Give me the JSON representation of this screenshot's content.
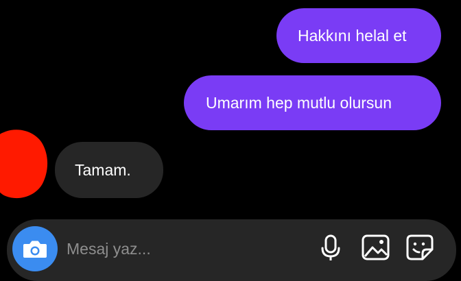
{
  "messages": [
    {
      "sender": "me",
      "text": "Hakkını helal et"
    },
    {
      "sender": "me",
      "text": "Umarım hep mutlu olursun"
    },
    {
      "sender": "other",
      "text": "Tamam."
    }
  ],
  "composer": {
    "placeholder": "Mesaj yaz..."
  },
  "icons": {
    "camera": "camera-icon",
    "microphone": "microphone-icon",
    "gallery": "image-gallery-icon",
    "sticker": "sticker-icon"
  },
  "colors": {
    "background": "#000000",
    "sent_bubble": "#7a3cf5",
    "received_bubble": "#262626",
    "composer": "#262626",
    "camera_button": "#3b8cf0",
    "placeholder": "#8e8e8e",
    "redaction": "#ff1a00"
  }
}
